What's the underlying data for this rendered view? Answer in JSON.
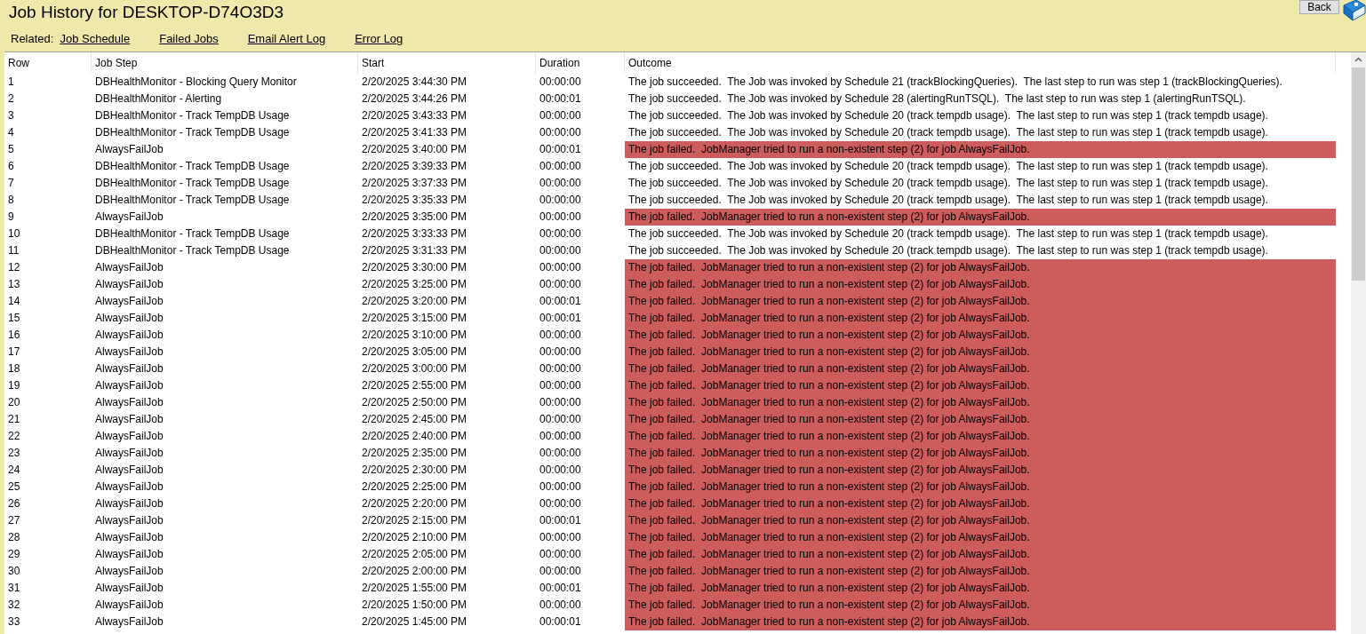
{
  "title": "Job History for DESKTOP-D74O3D3",
  "back_button": "Back",
  "related": {
    "label": "Related:",
    "links": [
      "Job Schedule",
      "Failed Jobs",
      "Email Alert Log",
      "Error Log"
    ]
  },
  "table": {
    "columns": [
      "Row",
      "Job Step",
      "Start",
      "Duration",
      "Outcome"
    ],
    "rows": [
      {
        "row": "1",
        "step": "DBHealthMonitor - Blocking Query Monitor",
        "start": "2/20/2025 3:44:30 PM",
        "duration": "00:00:00",
        "outcome": "The job succeeded.  The Job was invoked by Schedule 21 (trackBlockingQueries).  The last step to run was step 1 (trackBlockingQueries).",
        "failed": false
      },
      {
        "row": "2",
        "step": "DBHealthMonitor - Alerting",
        "start": "2/20/2025 3:44:26 PM",
        "duration": "00:00:01",
        "outcome": "The job succeeded.  The Job was invoked by Schedule 28 (alertingRunTSQL).  The last step to run was step 1 (alertingRunTSQL).",
        "failed": false
      },
      {
        "row": "3",
        "step": "DBHealthMonitor - Track TempDB Usage",
        "start": "2/20/2025 3:43:33 PM",
        "duration": "00:00:00",
        "outcome": "The job succeeded.  The Job was invoked by Schedule 20 (track tempdb usage).  The last step to run was step 1 (track tempdb usage).",
        "failed": false
      },
      {
        "row": "4",
        "step": "DBHealthMonitor - Track TempDB Usage",
        "start": "2/20/2025 3:41:33 PM",
        "duration": "00:00:00",
        "outcome": "The job succeeded.  The Job was invoked by Schedule 20 (track tempdb usage).  The last step to run was step 1 (track tempdb usage).",
        "failed": false
      },
      {
        "row": "5",
        "step": "AlwaysFailJob",
        "start": "2/20/2025 3:40:00 PM",
        "duration": "00:00:01",
        "outcome": "The job failed.  JobManager tried to run a non-existent step (2) for job AlwaysFailJob.",
        "failed": true
      },
      {
        "row": "6",
        "step": "DBHealthMonitor - Track TempDB Usage",
        "start": "2/20/2025 3:39:33 PM",
        "duration": "00:00:00",
        "outcome": "The job succeeded.  The Job was invoked by Schedule 20 (track tempdb usage).  The last step to run was step 1 (track tempdb usage).",
        "failed": false
      },
      {
        "row": "7",
        "step": "DBHealthMonitor - Track TempDB Usage",
        "start": "2/20/2025 3:37:33 PM",
        "duration": "00:00:00",
        "outcome": "The job succeeded.  The Job was invoked by Schedule 20 (track tempdb usage).  The last step to run was step 1 (track tempdb usage).",
        "failed": false
      },
      {
        "row": "8",
        "step": "DBHealthMonitor - Track TempDB Usage",
        "start": "2/20/2025 3:35:33 PM",
        "duration": "00:00:00",
        "outcome": "The job succeeded.  The Job was invoked by Schedule 20 (track tempdb usage).  The last step to run was step 1 (track tempdb usage).",
        "failed": false
      },
      {
        "row": "9",
        "step": "AlwaysFailJob",
        "start": "2/20/2025 3:35:00 PM",
        "duration": "00:00:00",
        "outcome": "The job failed.  JobManager tried to run a non-existent step (2) for job AlwaysFailJob.",
        "failed": true
      },
      {
        "row": "10",
        "step": "DBHealthMonitor - Track TempDB Usage",
        "start": "2/20/2025 3:33:33 PM",
        "duration": "00:00:00",
        "outcome": "The job succeeded.  The Job was invoked by Schedule 20 (track tempdb usage).  The last step to run was step 1 (track tempdb usage).",
        "failed": false
      },
      {
        "row": "11",
        "step": "DBHealthMonitor - Track TempDB Usage",
        "start": "2/20/2025 3:31:33 PM",
        "duration": "00:00:00",
        "outcome": "The job succeeded.  The Job was invoked by Schedule 20 (track tempdb usage).  The last step to run was step 1 (track tempdb usage).",
        "failed": false
      },
      {
        "row": "12",
        "step": "AlwaysFailJob",
        "start": "2/20/2025 3:30:00 PM",
        "duration": "00:00:00",
        "outcome": "The job failed.  JobManager tried to run a non-existent step (2) for job AlwaysFailJob.",
        "failed": true
      },
      {
        "row": "13",
        "step": "AlwaysFailJob",
        "start": "2/20/2025 3:25:00 PM",
        "duration": "00:00:00",
        "outcome": "The job failed.  JobManager tried to run a non-existent step (2) for job AlwaysFailJob.",
        "failed": true
      },
      {
        "row": "14",
        "step": "AlwaysFailJob",
        "start": "2/20/2025 3:20:00 PM",
        "duration": "00:00:01",
        "outcome": "The job failed.  JobManager tried to run a non-existent step (2) for job AlwaysFailJob.",
        "failed": true
      },
      {
        "row": "15",
        "step": "AlwaysFailJob",
        "start": "2/20/2025 3:15:00 PM",
        "duration": "00:00:01",
        "outcome": "The job failed.  JobManager tried to run a non-existent step (2) for job AlwaysFailJob.",
        "failed": true
      },
      {
        "row": "16",
        "step": "AlwaysFailJob",
        "start": "2/20/2025 3:10:00 PM",
        "duration": "00:00:00",
        "outcome": "The job failed.  JobManager tried to run a non-existent step (2) for job AlwaysFailJob.",
        "failed": true
      },
      {
        "row": "17",
        "step": "AlwaysFailJob",
        "start": "2/20/2025 3:05:00 PM",
        "duration": "00:00:00",
        "outcome": "The job failed.  JobManager tried to run a non-existent step (2) for job AlwaysFailJob.",
        "failed": true
      },
      {
        "row": "18",
        "step": "AlwaysFailJob",
        "start": "2/20/2025 3:00:00 PM",
        "duration": "00:00:00",
        "outcome": "The job failed.  JobManager tried to run a non-existent step (2) for job AlwaysFailJob.",
        "failed": true
      },
      {
        "row": "19",
        "step": "AlwaysFailJob",
        "start": "2/20/2025 2:55:00 PM",
        "duration": "00:00:00",
        "outcome": "The job failed.  JobManager tried to run a non-existent step (2) for job AlwaysFailJob.",
        "failed": true
      },
      {
        "row": "20",
        "step": "AlwaysFailJob",
        "start": "2/20/2025 2:50:00 PM",
        "duration": "00:00:00",
        "outcome": "The job failed.  JobManager tried to run a non-existent step (2) for job AlwaysFailJob.",
        "failed": true
      },
      {
        "row": "21",
        "step": "AlwaysFailJob",
        "start": "2/20/2025 2:45:00 PM",
        "duration": "00:00:00",
        "outcome": "The job failed.  JobManager tried to run a non-existent step (2) for job AlwaysFailJob.",
        "failed": true
      },
      {
        "row": "22",
        "step": "AlwaysFailJob",
        "start": "2/20/2025 2:40:00 PM",
        "duration": "00:00:00",
        "outcome": "The job failed.  JobManager tried to run a non-existent step (2) for job AlwaysFailJob.",
        "failed": true
      },
      {
        "row": "23",
        "step": "AlwaysFailJob",
        "start": "2/20/2025 2:35:00 PM",
        "duration": "00:00:00",
        "outcome": "The job failed.  JobManager tried to run a non-existent step (2) for job AlwaysFailJob.",
        "failed": true
      },
      {
        "row": "24",
        "step": "AlwaysFailJob",
        "start": "2/20/2025 2:30:00 PM",
        "duration": "00:00:00",
        "outcome": "The job failed.  JobManager tried to run a non-existent step (2) for job AlwaysFailJob.",
        "failed": true
      },
      {
        "row": "25",
        "step": "AlwaysFailJob",
        "start": "2/20/2025 2:25:00 PM",
        "duration": "00:00:00",
        "outcome": "The job failed.  JobManager tried to run a non-existent step (2) for job AlwaysFailJob.",
        "failed": true
      },
      {
        "row": "26",
        "step": "AlwaysFailJob",
        "start": "2/20/2025 2:20:00 PM",
        "duration": "00:00:00",
        "outcome": "The job failed.  JobManager tried to run a non-existent step (2) for job AlwaysFailJob.",
        "failed": true
      },
      {
        "row": "27",
        "step": "AlwaysFailJob",
        "start": "2/20/2025 2:15:00 PM",
        "duration": "00:00:01",
        "outcome": "The job failed.  JobManager tried to run a non-existent step (2) for job AlwaysFailJob.",
        "failed": true
      },
      {
        "row": "28",
        "step": "AlwaysFailJob",
        "start": "2/20/2025 2:10:00 PM",
        "duration": "00:00:00",
        "outcome": "The job failed.  JobManager tried to run a non-existent step (2) for job AlwaysFailJob.",
        "failed": true
      },
      {
        "row": "29",
        "step": "AlwaysFailJob",
        "start": "2/20/2025 2:05:00 PM",
        "duration": "00:00:00",
        "outcome": "The job failed.  JobManager tried to run a non-existent step (2) for job AlwaysFailJob.",
        "failed": true
      },
      {
        "row": "30",
        "step": "AlwaysFailJob",
        "start": "2/20/2025 2:00:00 PM",
        "duration": "00:00:00",
        "outcome": "The job failed.  JobManager tried to run a non-existent step (2) for job AlwaysFailJob.",
        "failed": true
      },
      {
        "row": "31",
        "step": "AlwaysFailJob",
        "start": "2/20/2025 1:55:00 PM",
        "duration": "00:00:01",
        "outcome": "The job failed.  JobManager tried to run a non-existent step (2) for job AlwaysFailJob.",
        "failed": true
      },
      {
        "row": "32",
        "step": "AlwaysFailJob",
        "start": "2/20/2025 1:50:00 PM",
        "duration": "00:00:00",
        "outcome": "The job failed.  JobManager tried to run a non-existent step (2) for job AlwaysFailJob.",
        "failed": true
      },
      {
        "row": "33",
        "step": "AlwaysFailJob",
        "start": "2/20/2025 1:45:00 PM",
        "duration": "00:00:01",
        "outcome": "The job failed.  JobManager tried to run a non-existent step (2) for job AlwaysFailJob.",
        "failed": true
      }
    ]
  }
}
